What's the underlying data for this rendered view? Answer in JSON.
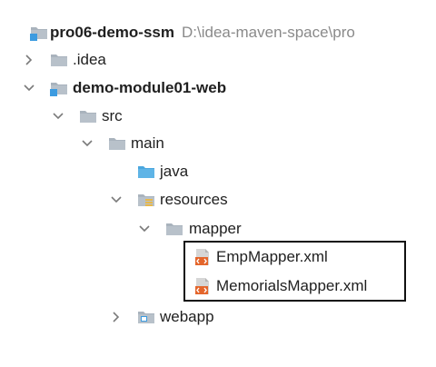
{
  "colors": {
    "folder": "#a9b3bd",
    "folder_dark": "#8f9aa5",
    "source_folder": "#5fb4e6",
    "module_marker": "#3c9be0",
    "resource_stripes": "#e8b84a",
    "xml_orange": "#e4662c",
    "chevron": "#7a7a7a",
    "path_gray": "#8a8a8a",
    "highlight_border": "#111111"
  },
  "tree": {
    "project": {
      "name": "pro06-demo-ssm",
      "path": "D:\\idea-maven-space\\pro",
      "icon": "module-folder-icon"
    },
    "idea": {
      "name": ".idea",
      "icon": "folder-icon",
      "state": "collapsed"
    },
    "module": {
      "name": "demo-module01-web",
      "icon": "module-folder-icon",
      "state": "expanded"
    },
    "src": {
      "name": "src",
      "icon": "folder-icon",
      "state": "expanded"
    },
    "main": {
      "name": "main",
      "icon": "folder-icon",
      "state": "expanded"
    },
    "java": {
      "name": "java",
      "icon": "source-folder-icon"
    },
    "resources": {
      "name": "resources",
      "icon": "resources-folder-icon",
      "state": "expanded"
    },
    "mapper": {
      "name": "mapper",
      "icon": "folder-icon",
      "state": "expanded"
    },
    "files": [
      {
        "name": "EmpMapper.xml",
        "icon": "xml-file-icon"
      },
      {
        "name": "MemorialsMapper.xml",
        "icon": "xml-file-icon"
      }
    ],
    "webapp": {
      "name": "webapp",
      "icon": "web-folder-icon",
      "state": "collapsed"
    }
  }
}
